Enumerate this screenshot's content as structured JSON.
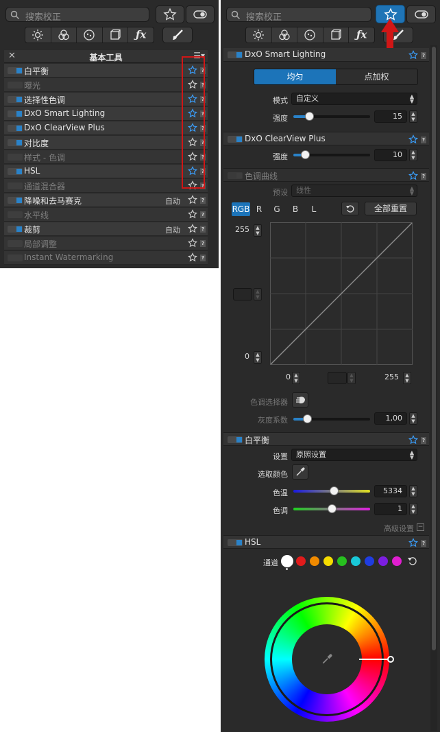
{
  "left_panel": {
    "search_placeholder": "搜索校正",
    "list_title": "基本工具",
    "items": [
      {
        "label": "白平衡",
        "enabled": true,
        "starred": true,
        "auto": ""
      },
      {
        "label": "曝光",
        "enabled": false,
        "starred": false,
        "auto": ""
      },
      {
        "label": "选择性色调",
        "enabled": true,
        "starred": true,
        "auto": ""
      },
      {
        "label": "DxO Smart Lighting",
        "enabled": true,
        "starred": true,
        "auto": ""
      },
      {
        "label": "DxO ClearView Plus",
        "enabled": true,
        "starred": true,
        "auto": ""
      },
      {
        "label": "对比度",
        "enabled": true,
        "starred": false,
        "auto": ""
      },
      {
        "label": "样式 - 色调",
        "enabled": false,
        "starred": false,
        "auto": ""
      },
      {
        "label": "HSL",
        "enabled": true,
        "starred": true,
        "auto": ""
      },
      {
        "label": "通道混合器",
        "enabled": false,
        "starred": false,
        "auto": ""
      },
      {
        "label": "降噪和去马赛克",
        "enabled": true,
        "starred": false,
        "auto": "自动"
      },
      {
        "label": "水平线",
        "enabled": false,
        "starred": false,
        "auto": ""
      },
      {
        "label": "裁剪",
        "enabled": true,
        "starred": false,
        "auto": "自动"
      },
      {
        "label": "局部调整",
        "enabled": false,
        "starred": false,
        "auto": ""
      },
      {
        "label": "Instant Watermarking",
        "enabled": false,
        "starred": false,
        "auto": ""
      }
    ]
  },
  "right_panel": {
    "search_placeholder": "搜索校正",
    "smart_lighting": {
      "title": "DxO Smart Lighting",
      "mode_tabs": [
        "均匀",
        "点加权"
      ],
      "active_tab": "均匀",
      "mode_label": "模式",
      "mode_value": "自定义",
      "strength_label": "强度",
      "strength_value": "15",
      "strength_level": 0.15
    },
    "clearview": {
      "title": "DxO ClearView Plus",
      "strength_label": "强度",
      "strength_value": "10",
      "strength_level": 0.1
    },
    "tone_curve": {
      "title": "色调曲线",
      "preset_label": "预设",
      "preset_value": "线性",
      "channels": [
        "RGB",
        "R",
        "G",
        "B",
        "L"
      ],
      "active_channel": "RGB",
      "reset_all": "全部重置",
      "output_max": "255",
      "output_min": "0",
      "input_min": "0",
      "input_max": "255",
      "picker_label": "色调选择器",
      "gamma_label": "灰度系数",
      "gamma_value": "1,00"
    },
    "white_balance": {
      "title": "白平衡",
      "setting_label": "设置",
      "setting_value": "原照设置",
      "pick_label": "选取颜色",
      "temp_label": "色温",
      "temp_value": "5334",
      "tint_label": "色调",
      "tint_value": "1",
      "advanced": "高级设置"
    },
    "hsl": {
      "title": "HSL",
      "channel_label": "通道",
      "swatches": [
        "#ffffff",
        "#e11b1b",
        "#f08a00",
        "#f5dc00",
        "#27c01f",
        "#19c8d8",
        "#1f3de0",
        "#7c1ee0",
        "#e01ed0"
      ]
    }
  },
  "colors": {
    "accent": "#1c74b9",
    "annotation_red": "#d01616",
    "panel_bg": "#2a2a2a"
  }
}
